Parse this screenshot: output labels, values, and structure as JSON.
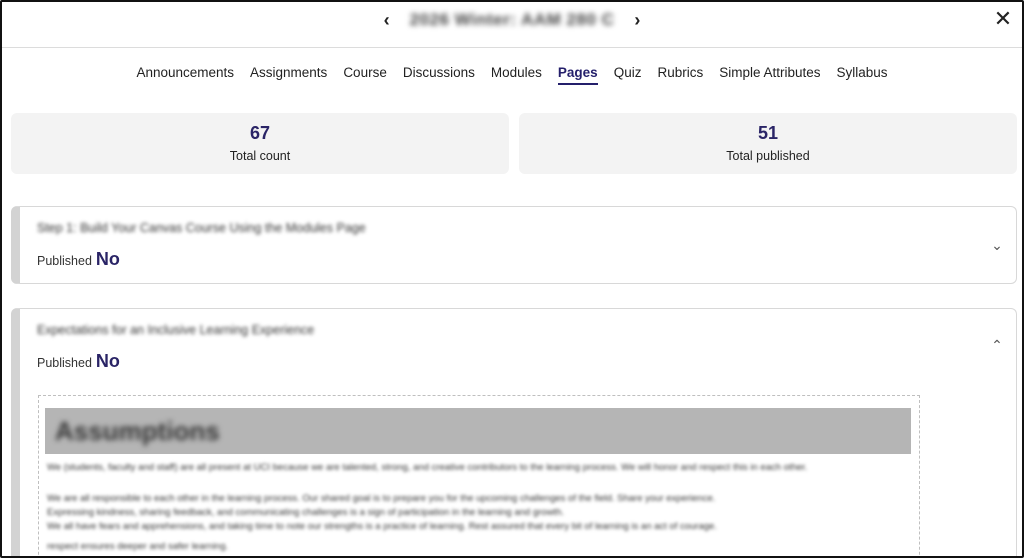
{
  "header": {
    "course_title": "2026 Winter: AAM 280 C",
    "prev_icon": "chevron-left-icon",
    "next_icon": "chevron-right-icon",
    "close_icon": "close-icon"
  },
  "tabs": [
    {
      "label": "Announcements"
    },
    {
      "label": "Assignments"
    },
    {
      "label": "Course"
    },
    {
      "label": "Discussions"
    },
    {
      "label": "Modules"
    },
    {
      "label": "Pages",
      "active": true
    },
    {
      "label": "Quiz"
    },
    {
      "label": "Rubrics"
    },
    {
      "label": "Simple Attributes"
    },
    {
      "label": "Syllabus"
    }
  ],
  "stats": {
    "total_count": {
      "value": "67",
      "label": "Total count"
    },
    "total_published": {
      "value": "51",
      "label": "Total published"
    }
  },
  "pages": [
    {
      "title": "Step 1: Build Your Canvas Course Using the Modules Page",
      "published_label": "Published",
      "published_value": "No",
      "expanded": false,
      "toggle_icon": "chevron-down-icon"
    },
    {
      "title": "Expectations for an Inclusive Learning Experience",
      "published_label": "Published",
      "published_value": "No",
      "expanded": true,
      "toggle_icon": "chevron-up-icon",
      "content": {
        "heading": "Assumptions",
        "lines": [
          "We (students, faculty and staff) are all present at UCI because we are talented, strong, and creative contributors to the learning process. We will honor and respect this in each other.",
          "We are all responsible to each other in the learning process. Our shared goal is to prepare you for the upcoming challenges of the field. Share your experience.",
          "Expressing kindness, sharing feedback, and communicating challenges is a sign of participation in the learning and growth.",
          "We all have fears and apprehensions, and taking time to note our strengths is a practice of learning. Rest assured that every bit of learning is an act of courage.",
          "respect ensures deeper and safer learning."
        ]
      }
    }
  ]
}
